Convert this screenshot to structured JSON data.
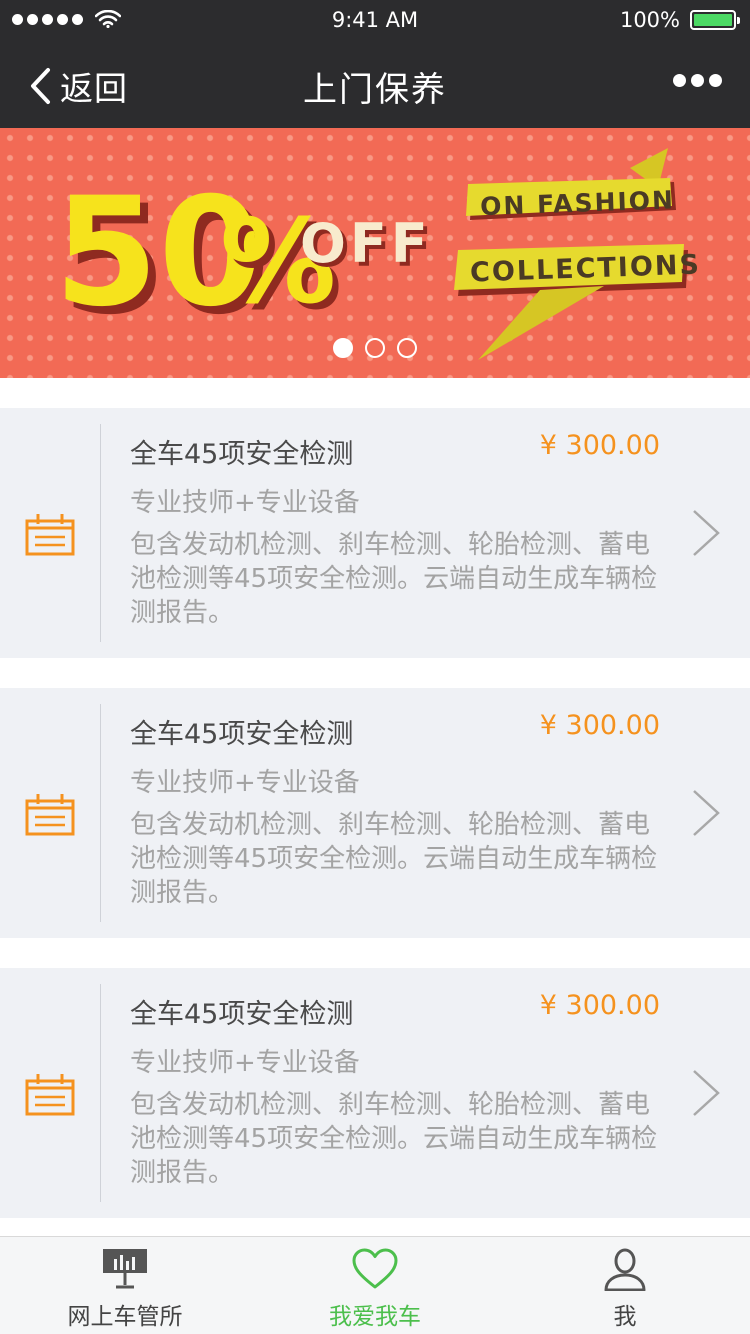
{
  "status_bar": {
    "time": "9:41 AM",
    "battery": "100%"
  },
  "nav": {
    "back_label": "返回",
    "title": "上门保养"
  },
  "banner": {
    "big_number": "50",
    "percent": "%",
    "off": "OFF",
    "ribbon_line1": "ON FASHION",
    "ribbon_line2": "COLLECTIONS",
    "page_count": 3,
    "active_page": 1
  },
  "services": [
    {
      "title": "全车45项安全检测",
      "price": "¥ 300.00",
      "subtitle": "专业技师+专业设备",
      "description": "包含发动机检测、刹车检测、轮胎检测、蓄电池检测等45项安全检测。云端自动生成车辆检测报告。"
    },
    {
      "title": "全车45项安全检测",
      "price": "¥ 300.00",
      "subtitle": "专业技师+专业设备",
      "description": "包含发动机检测、刹车检测、轮胎检测、蓄电池检测等45项安全检测。云端自动生成车辆检测报告。"
    },
    {
      "title": "全车45项安全检测",
      "price": "¥ 300.00",
      "subtitle": "专业技师+专业设备",
      "description": "包含发动机检测、刹车检测、轮胎检测、蓄电池检测等45项安全检测。云端自动生成车辆检测报告。"
    }
  ],
  "tabs": [
    {
      "label": "网上车管所",
      "icon": "chart-board-icon",
      "active": false
    },
    {
      "label": "我爱我车",
      "icon": "heart-icon",
      "active": true
    },
    {
      "label": "我",
      "icon": "user-icon",
      "active": false
    }
  ],
  "colors": {
    "nav_bg": "#2c2c2e",
    "banner_bg": "#f26a55",
    "accent_orange": "#f5921e",
    "active_green": "#4cbf4c",
    "card_bg": "#eff1f5"
  }
}
